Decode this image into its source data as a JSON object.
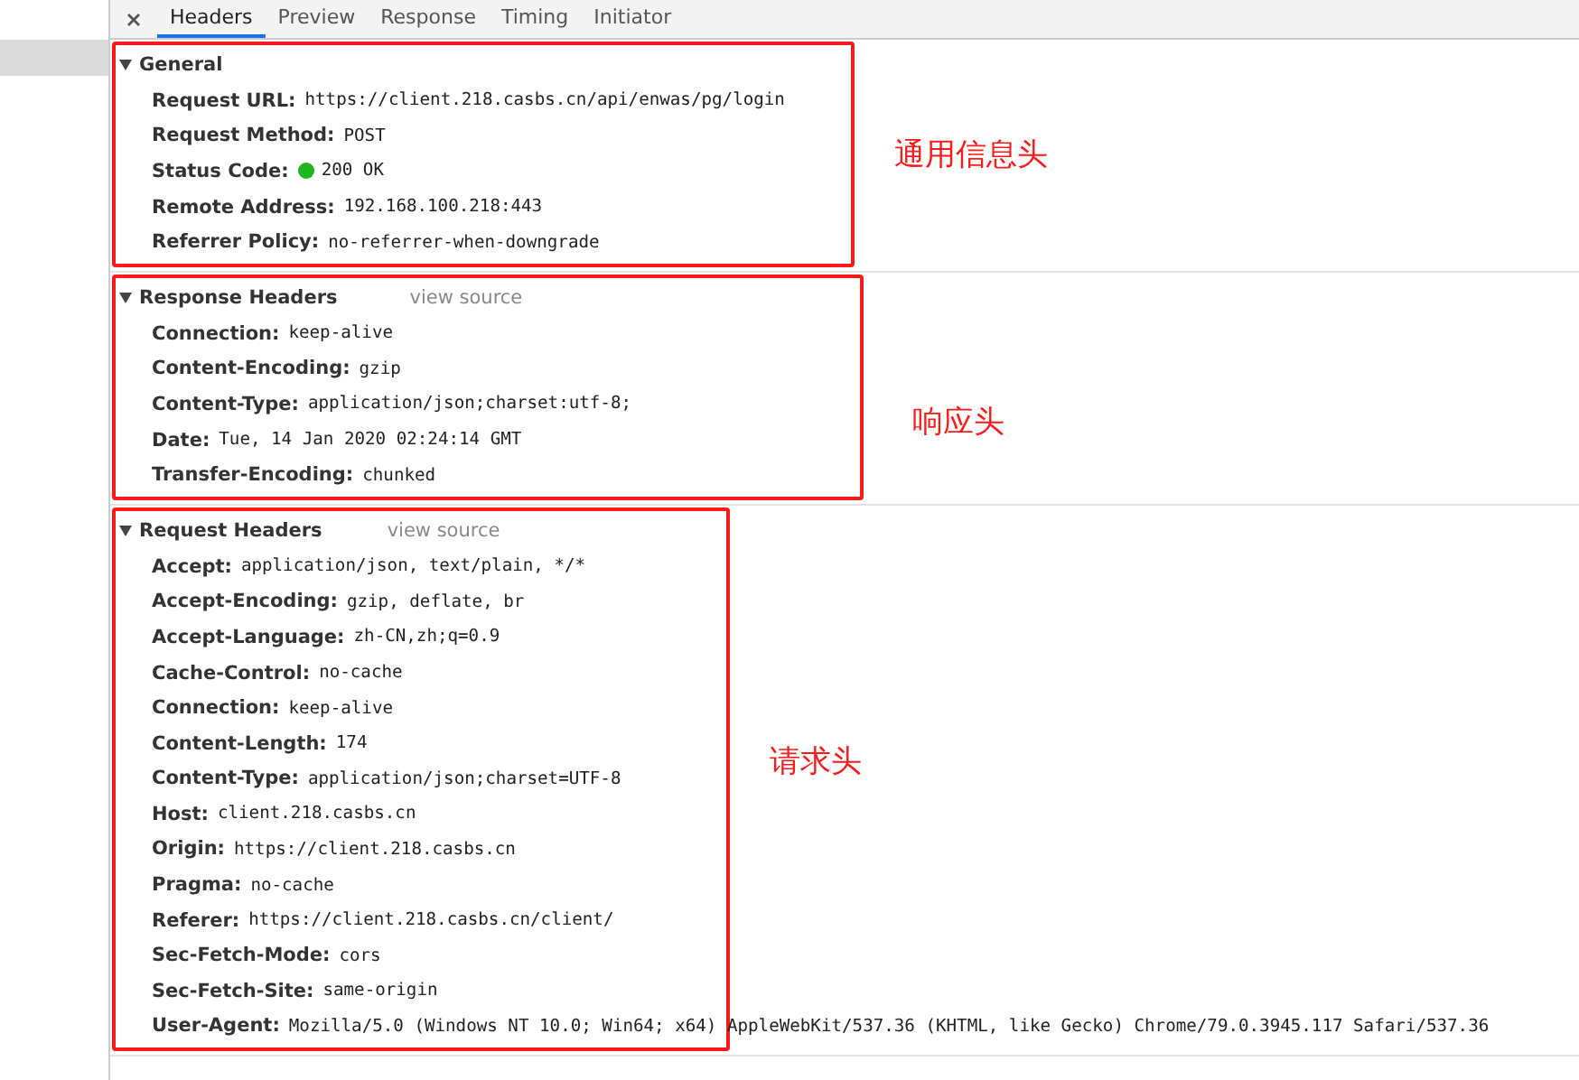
{
  "tabs": [
    {
      "label": "Headers",
      "selected": true
    },
    {
      "label": "Preview",
      "selected": false
    },
    {
      "label": "Response",
      "selected": false
    },
    {
      "label": "Timing",
      "selected": false
    },
    {
      "label": "Initiator",
      "selected": false
    }
  ],
  "sections": [
    {
      "title": "General",
      "expanded": true,
      "annotation": "通用信息头",
      "rows": [
        {
          "name": "Request URL:",
          "value": "https://client.218.casbs.cn/api/enwas/pg/login"
        },
        {
          "name": "Request Method:",
          "value": "POST"
        },
        {
          "name": "Status Code:",
          "value": "200 OK",
          "color": "#1fb51f"
        },
        {
          "name": "Remote Address:",
          "value": "192.168.100.218:443"
        },
        {
          "name": "Referrer Policy:",
          "value": "no-referrer-when-downgrade"
        }
      ]
    },
    {
      "title": "Response Headers",
      "link": "view source",
      "expanded": true,
      "annotation": "响应头",
      "rows": [
        {
          "name": "Connection:",
          "value": "keep-alive"
        },
        {
          "name": "Content-Encoding:",
          "value": "gzip"
        },
        {
          "name": "Content-Type:",
          "value": "application/json;charset:utf-8;"
        },
        {
          "name": "Date:",
          "value": "Tue, 14 Jan 2020 02:24:14 GMT"
        },
        {
          "name": "Transfer-Encoding:",
          "value": "chunked"
        }
      ]
    },
    {
      "title": "Request Headers",
      "link": "view source",
      "expanded": true,
      "annotation": "请求头",
      "rows": [
        {
          "name": "Accept:",
          "value": "application/json, text/plain, */*"
        },
        {
          "name": "Accept-Encoding:",
          "value": "gzip, deflate, br"
        },
        {
          "name": "Accept-Language:",
          "value": "zh-CN,zh;q=0.9"
        },
        {
          "name": "Cache-Control:",
          "value": "no-cache"
        },
        {
          "name": "Connection:",
          "value": "keep-alive"
        },
        {
          "name": "Content-Length:",
          "value": "174"
        },
        {
          "name": "Content-Type:",
          "value": "application/json;charset=UTF-8"
        },
        {
          "name": "Host:",
          "value": "client.218.casbs.cn"
        },
        {
          "name": "Origin:",
          "value": "https://client.218.casbs.cn"
        },
        {
          "name": "Pragma:",
          "value": "no-cache"
        },
        {
          "name": "Referer:",
          "value": "https://client.218.casbs.cn/client/"
        },
        {
          "name": "Sec-Fetch-Mode:",
          "value": "cors"
        },
        {
          "name": "Sec-Fetch-Site:",
          "value": "same-origin"
        },
        {
          "name": "User-Agent:",
          "value": "Mozilla/5.0 (Windows NT 10.0; Win64; x64) AppleWebKit/537.36 (KHTML, like Gecko) Chrome/79.0.3945.117 Safari/537.36"
        }
      ]
    }
  ]
}
